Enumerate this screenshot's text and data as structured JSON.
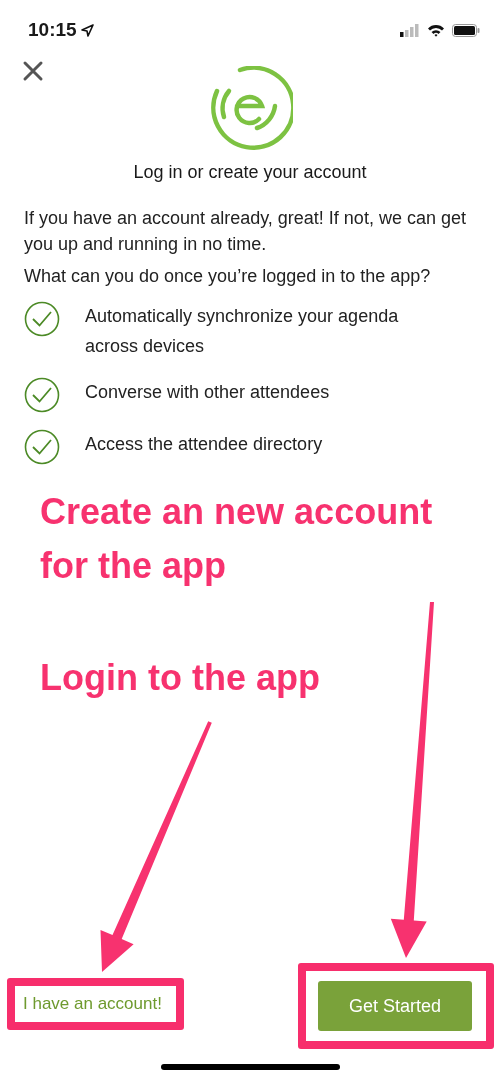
{
  "status_bar": {
    "time": "10:15"
  },
  "title": "Log in or create your account",
  "intro": [
    "If you have an account already, great! If not, we can get you up and running in no time.",
    "What can you do once you’re logged in to the app?"
  ],
  "features": [
    {
      "label": "Automatically synchronize your agenda across devices",
      "checked": true
    },
    {
      "label": "Converse with other attendees",
      "checked": true
    },
    {
      "label": "Access the attendee directory",
      "checked": true
    }
  ],
  "annotations": [
    {
      "text": "Create an new account for the app"
    },
    {
      "text": "Login to the app"
    }
  ],
  "actions": {
    "secondary": "I have an account!",
    "primary": "Get Started"
  }
}
